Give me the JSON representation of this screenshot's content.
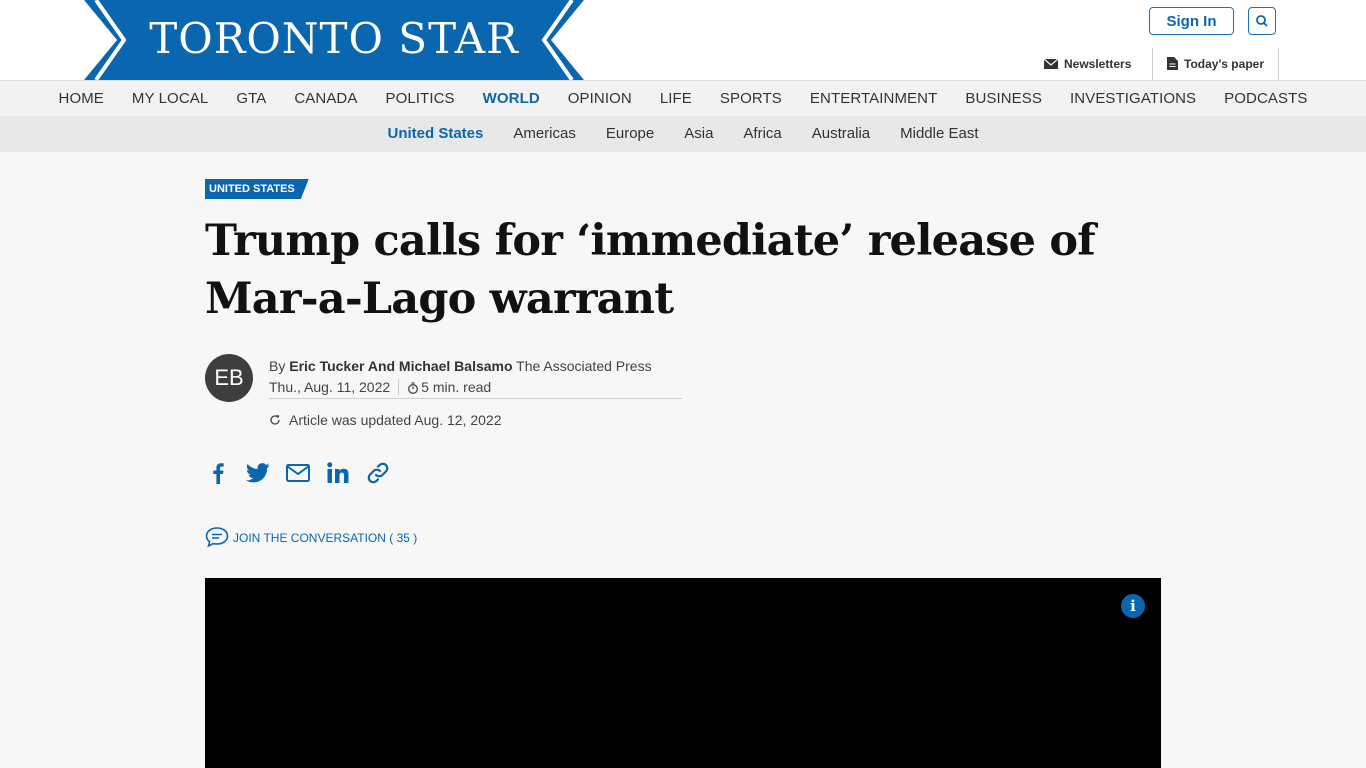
{
  "header": {
    "logo_text": "TORONTO STAR",
    "sign_in_label": "Sign In",
    "newsletters_label": "Newsletters",
    "todays_paper_label": "Today's paper",
    "brand_color": "#0b66b0"
  },
  "primary_nav": {
    "items": [
      {
        "label": "HOME"
      },
      {
        "label": "MY LOCAL"
      },
      {
        "label": "GTA"
      },
      {
        "label": "CANADA"
      },
      {
        "label": "POLITICS"
      },
      {
        "label": "WORLD"
      },
      {
        "label": "OPINION"
      },
      {
        "label": "LIFE"
      },
      {
        "label": "SPORTS"
      },
      {
        "label": "ENTERTAINMENT"
      },
      {
        "label": "BUSINESS"
      },
      {
        "label": "INVESTIGATIONS"
      },
      {
        "label": "PODCASTS"
      }
    ],
    "active": "WORLD"
  },
  "secondary_nav": {
    "items": [
      {
        "label": "United States"
      },
      {
        "label": "Americas"
      },
      {
        "label": "Europe"
      },
      {
        "label": "Asia"
      },
      {
        "label": "Africa"
      },
      {
        "label": "Australia"
      },
      {
        "label": "Middle East"
      }
    ],
    "active": "United States"
  },
  "article": {
    "section_tag": "UNITED STATES",
    "headline": "Trump calls for ‘immediate’ release of Mar-a-Lago warrant",
    "avatar_initials": "EB",
    "by_prefix": "By",
    "authors": "Eric Tucker And Michael Balsamo",
    "outlet": "The Associated Press",
    "date": "Thu., Aug. 11, 2022",
    "read_time": "5 min. read",
    "updated_text": "Article was updated Aug. 12, 2022",
    "conversation_label": "JOIN THE CONVERSATION ( 35 )"
  },
  "icons": {
    "share": [
      "facebook-icon",
      "twitter-icon",
      "email-icon",
      "linkedin-icon",
      "link-icon"
    ]
  }
}
